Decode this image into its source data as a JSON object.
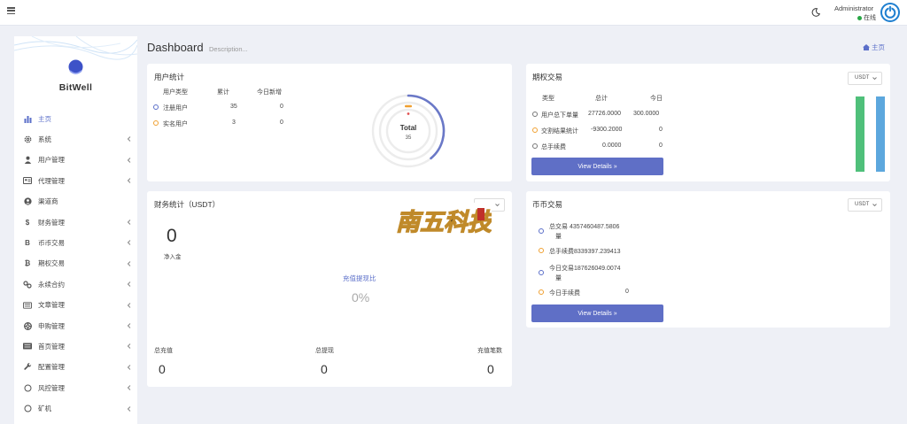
{
  "topbar": {
    "user_name": "Administrator",
    "user_status": "在线"
  },
  "sidebar": {
    "logo_text": "BitWell",
    "items": [
      {
        "label": "主页",
        "icon": "bar-chart-icon",
        "glyph": "",
        "expandable": false,
        "active": true
      },
      {
        "label": "系统",
        "icon": "gear-icon",
        "glyph": "",
        "expandable": true,
        "active": false
      },
      {
        "label": "用户管理",
        "icon": "user-icon",
        "glyph": "",
        "expandable": true,
        "active": false
      },
      {
        "label": "代理管理",
        "icon": "id-card-icon",
        "glyph": "",
        "expandable": true,
        "active": false
      },
      {
        "label": "渠道商",
        "icon": "user-circle-icon",
        "glyph": "",
        "expandable": false,
        "active": false
      },
      {
        "label": "财务管理",
        "icon": "dollar-icon",
        "glyph": "$",
        "expandable": true,
        "active": false
      },
      {
        "label": "币币交易",
        "icon": "bitcoin-icon",
        "glyph": "B",
        "expandable": true,
        "active": false
      },
      {
        "label": "期权交易",
        "icon": "bitcoin-icon",
        "glyph": "₿",
        "expandable": true,
        "active": false
      },
      {
        "label": "永续合约",
        "icon": "link-icon",
        "glyph": "",
        "expandable": true,
        "active": false
      },
      {
        "label": "文章管理",
        "icon": "keyboard-icon",
        "glyph": "",
        "expandable": true,
        "active": false
      },
      {
        "label": "申购管理",
        "icon": "life-ring-icon",
        "glyph": "",
        "expandable": true,
        "active": false
      },
      {
        "label": "首页管理",
        "icon": "list-icon",
        "glyph": "",
        "expandable": true,
        "active": false
      },
      {
        "label": "配置管理",
        "icon": "wrench-icon",
        "glyph": "",
        "expandable": true,
        "active": false
      },
      {
        "label": "风控管理",
        "icon": "circle-icon",
        "glyph": "",
        "expandable": true,
        "active": false
      },
      {
        "label": "矿机",
        "icon": "circle-icon",
        "glyph": "",
        "expandable": true,
        "active": false
      }
    ]
  },
  "header": {
    "title": "Dashboard",
    "description": "Description...",
    "breadcrumb": "主页"
  },
  "user_stats": {
    "title": "用户统计",
    "columns": [
      "用户类型",
      "累计",
      "今日新增"
    ],
    "rows": [
      {
        "type": "注册用户",
        "total": "35",
        "today": "0"
      },
      {
        "type": "实名用户",
        "total": "3",
        "today": "0"
      }
    ],
    "donut_label": "Total",
    "donut_value": "35",
    "donut_progress": 0.39
  },
  "options": {
    "title": "期权交易",
    "select": "USDT",
    "columns": [
      "类型",
      "总计",
      "今日"
    ],
    "rows": [
      {
        "type": "用户总下单量",
        "total": "27726.0000",
        "today": "300.0000"
      },
      {
        "type": "交割结果统计",
        "total": "-9300.2000",
        "today": "0"
      },
      {
        "type": "总手续费",
        "total": "0.0000",
        "today": "0"
      }
    ],
    "button": "View Details »",
    "bars": [
      {
        "color": "#4fc07a",
        "value": 0.95
      },
      {
        "color": "#5ca7dd",
        "value": 0.95
      }
    ]
  },
  "finance": {
    "title": "财务统计（USDT）",
    "net_value": "0",
    "net_label": "净入金",
    "ratio_title": "充值提现比",
    "ratio_value": "0%",
    "totals": [
      {
        "label": "总充值",
        "value": "0"
      },
      {
        "label": "总提现",
        "value": "0"
      },
      {
        "label": "充值笔数",
        "value": "0"
      }
    ],
    "watermark_text": "南五科技"
  },
  "spot": {
    "title": "币币交易",
    "select": "USDT",
    "rows": [
      {
        "line1": "总交易 4357460487.5806",
        "line2": "量"
      },
      {
        "line1": "总手续费8339397.239413",
        "line2": ""
      },
      {
        "line1": "今日交易187626049.0074",
        "line2": "量"
      },
      {
        "line1": "今日手续费",
        "line2": "",
        "value": "0"
      }
    ],
    "button": "View Details »"
  },
  "colors": {
    "accent": "#5f6fc6",
    "green": "#4fc07a",
    "blue": "#5ca7dd",
    "orange": "#f0a030"
  }
}
